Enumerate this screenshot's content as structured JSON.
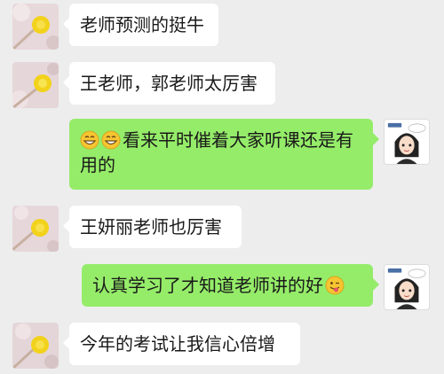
{
  "messages": [
    {
      "side": "left",
      "text": "老师预测的挺牛"
    },
    {
      "side": "left",
      "text": "王老师，郭老师太厉害"
    },
    {
      "side": "right",
      "emojis": [
        "grinning-face-emoji",
        "grinning-face-emoji"
      ],
      "text": "看来平时催着大家听课还是有用的"
    },
    {
      "side": "left",
      "text": "王妍丽老师也厉害"
    },
    {
      "side": "right",
      "text": "认真学习了才知道老师讲的好",
      "trailing_emoji": "winking-tongue-emoji"
    },
    {
      "side": "left",
      "text": "今年的考试让我信心倍增"
    }
  ],
  "colors": {
    "background": "#ededed",
    "incoming_bubble": "#ffffff",
    "outgoing_bubble": "#95ec69"
  }
}
